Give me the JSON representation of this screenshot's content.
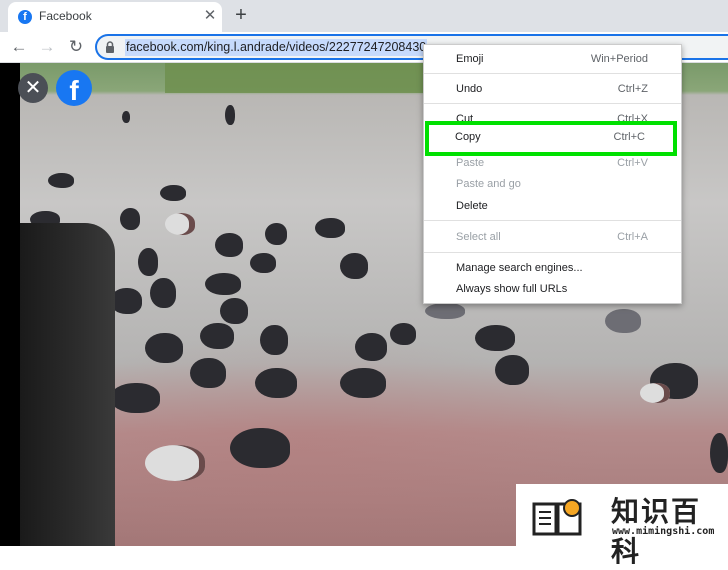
{
  "browser": {
    "tab": {
      "title": "Facebook",
      "favicon_letter": "f",
      "close_glyph": "✕"
    },
    "new_tab_glyph": "+",
    "nav": {
      "back_glyph": "←",
      "forward_glyph": "→",
      "reload_glyph": "↻"
    },
    "address_bar": {
      "url": "facebook.com/king.l.andrade/videos/22277247208430"
    }
  },
  "page": {
    "close_video_glyph": "✕",
    "facebook_logo_letter": "f"
  },
  "context_menu": {
    "items": [
      {
        "label": "Emoji",
        "shortcut": "Win+Period",
        "enabled": true
      },
      {
        "label": "Undo",
        "shortcut": "Ctrl+Z",
        "enabled": true
      },
      {
        "label": "Cut",
        "shortcut": "Ctrl+X",
        "enabled": true
      },
      {
        "label": "Copy",
        "shortcut": "Ctrl+C",
        "enabled": true,
        "highlighted": true
      },
      {
        "label": "Paste",
        "shortcut": "Ctrl+V",
        "enabled": false
      },
      {
        "label": "Paste and go",
        "shortcut": "",
        "enabled": false
      },
      {
        "label": "Delete",
        "shortcut": "",
        "enabled": true
      },
      {
        "label": "Select all",
        "shortcut": "Ctrl+A",
        "enabled": false
      },
      {
        "label": "Manage search engines...",
        "shortcut": "",
        "enabled": true
      },
      {
        "label": "Always show full URLs",
        "shortcut": "",
        "enabled": true
      }
    ]
  },
  "watermark": {
    "title": "知识百科",
    "url": "www.mimingshi.com"
  },
  "colors": {
    "highlight_border": "#00e000",
    "facebook_blue": "#1877f2",
    "selection": "#c6dafc"
  }
}
